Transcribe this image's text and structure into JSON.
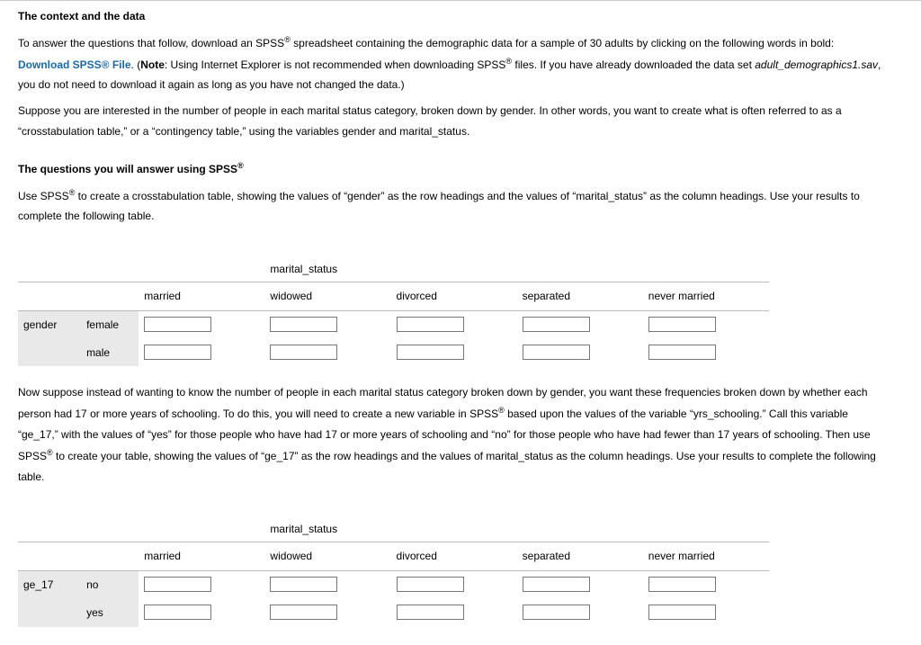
{
  "section1_title": "The context and the data",
  "p1a": "To answer the questions that follow, download an SPSS",
  "p1b": " spreadsheet containing the demographic data for a sample of 30 adults by clicking on the following words in bold: ",
  "link_text": "Download SPSS® File",
  "p1c": ". (",
  "note_label": "Note",
  "p1d": ": Using Internet Explorer is not recommended when downloading SPSS",
  "p1e": " files. If you have already downloaded the data set ",
  "fname": "adult_demographics1.sav",
  "p1f": ", you do not need to download it again as long as you have not changed the data.)",
  "p2": "Suppose you are interested in the number of people in each marital status category, broken down by gender. In other words, you want to create what is often referred to as a “crosstabulation table,” or a “contingency table,” using the variables gender and marital_status.",
  "section2a": "The questions you will answer using SPSS",
  "p3a": "Use SPSS",
  "p3b": " to create a crosstabulation table, showing the values of “gender” as the row headings and the values of “marital_status” as the column headings. Use your results to complete the following table.",
  "table1": {
    "super": "marital_status",
    "cols": [
      "married",
      "widowed",
      "divorced",
      "separated",
      "never married"
    ],
    "row_var": "gender",
    "row_vals": [
      "female",
      "male"
    ]
  },
  "p4a": "Now suppose instead of wanting to know the number of people in each marital status category broken down by gender, you want these frequencies broken down by whether each person had 17 or more years of schooling. To do this, you will need to create a new variable in SPSS",
  "p4b": " based upon the values of the variable “yrs_schooling.” Call this variable “ge_17,” with the values of “yes” for those people who have had 17 or more years of schooling and “no” for those people who have had fewer than 17 years of schooling. Then use SPSS",
  "p4c": " to create your table, showing the values of “ge_17” as the row headings and the values of marital_status as the column headings. Use your results to complete the following table.",
  "table2": {
    "super": "marital_status",
    "cols": [
      "married",
      "widowed",
      "divorced",
      "separated",
      "never married"
    ],
    "row_var": "ge_17",
    "row_vals": [
      "no",
      "yes"
    ]
  },
  "reg": "®"
}
